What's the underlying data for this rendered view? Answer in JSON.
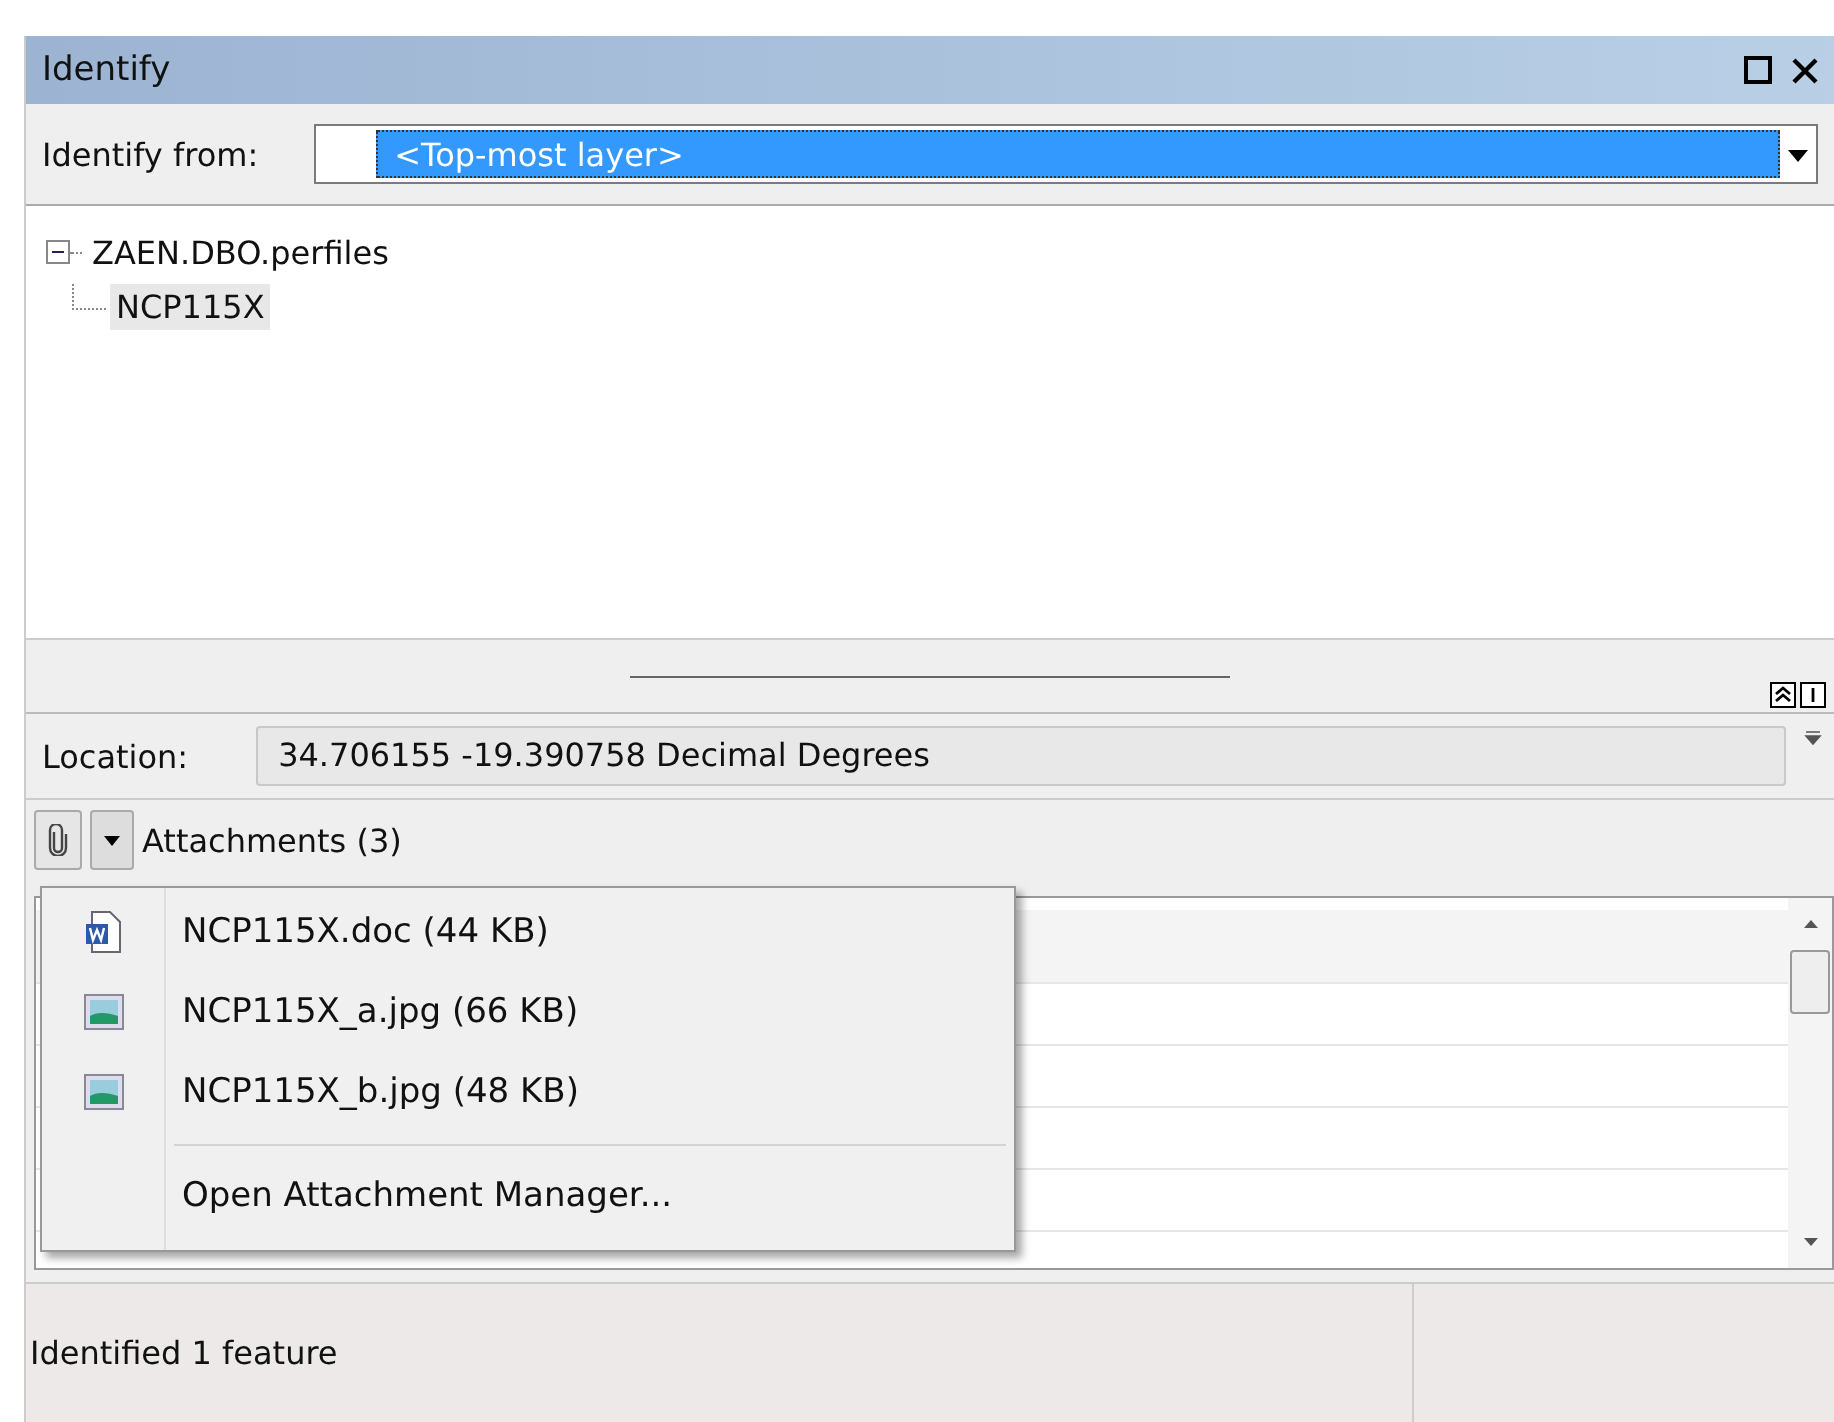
{
  "window": {
    "title": "Identify"
  },
  "identify_from": {
    "label": "Identify from:",
    "value": "<Top-most layer>"
  },
  "tree": [
    {
      "label": "ZAEN.DBO.perfiles",
      "expanded": true,
      "selected": false,
      "children": [
        {
          "label": "NCP115X",
          "selected": true
        }
      ]
    }
  ],
  "location": {
    "label": "Location:",
    "value": "34.706155  -19.390758 Decimal Degrees"
  },
  "attachments": {
    "label": "Attachments (3)"
  },
  "attachment_menu": [
    {
      "kind": "doc",
      "label": "NCP115X.doc (44 KB)"
    },
    {
      "kind": "image",
      "label": "NCP115X_a.jpg (66 KB)"
    },
    {
      "kind": "image",
      "label": "NCP115X_b.jpg (48 KB)"
    },
    {
      "kind": "action",
      "label": "Open Attachment Manager..."
    }
  ],
  "status_bar": {
    "text": "Identified 1 feature"
  }
}
